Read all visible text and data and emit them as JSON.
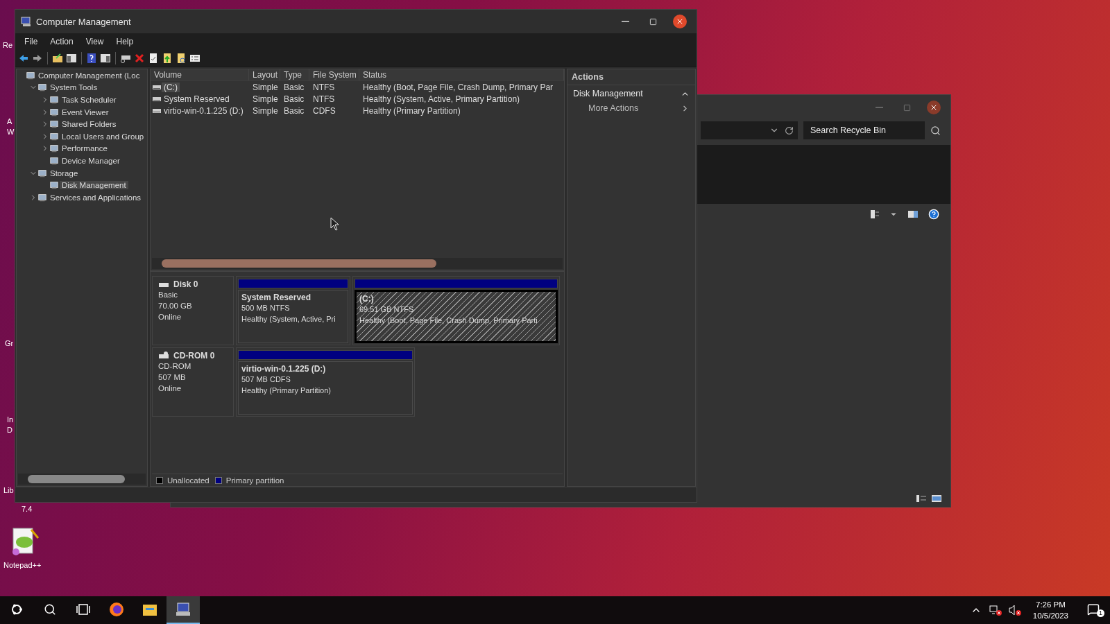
{
  "desktop": {
    "icons": [
      {
        "lines": [
          "Re"
        ]
      },
      {
        "lines": [
          "A",
          "W"
        ]
      },
      {
        "lines": [
          "Gr"
        ]
      },
      {
        "lines": [
          "In",
          "D"
        ]
      },
      {
        "lines": [
          "Lib",
          "7.4"
        ]
      },
      {
        "lines": [
          "Notepad++"
        ]
      }
    ]
  },
  "window": {
    "title": "Computer Management",
    "menu": [
      "File",
      "Action",
      "View",
      "Help"
    ],
    "tree": [
      {
        "label": "Computer Management (Loc",
        "selected": false,
        "children": [
          {
            "label": "System Tools",
            "expanded": true,
            "selected": false,
            "children": [
              {
                "label": "Task Scheduler",
                "expanded": false,
                "selected": false
              },
              {
                "label": "Event Viewer",
                "expanded": false,
                "selected": false
              },
              {
                "label": "Shared Folders",
                "expanded": false,
                "selected": false
              },
              {
                "label": "Local Users and Group",
                "expanded": false,
                "selected": false
              },
              {
                "label": "Performance",
                "expanded": false,
                "selected": false
              },
              {
                "label": "Device Manager",
                "selected": false
              }
            ]
          },
          {
            "label": "Storage",
            "expanded": true,
            "selected": false,
            "children": [
              {
                "label": "Disk Management",
                "selected": true
              }
            ]
          },
          {
            "label": "Services and Applications",
            "expanded": false,
            "selected": false
          }
        ]
      }
    ],
    "volumes": {
      "columns": [
        "Volume",
        "Layout",
        "Type",
        "File System",
        "Status"
      ],
      "rows": [
        {
          "selected": true,
          "cells": [
            "(C:)",
            "Simple",
            "Basic",
            "NTFS",
            "Healthy (Boot, Page File, Crash Dump, Primary Par"
          ]
        },
        {
          "selected": false,
          "cells": [
            "System Reserved",
            "Simple",
            "Basic",
            "NTFS",
            "Healthy (System, Active, Primary Partition)"
          ]
        },
        {
          "selected": false,
          "cells": [
            "virtio-win-0.1.225 (D:)",
            "Simple",
            "Basic",
            "CDFS",
            "Healthy (Primary Partition)"
          ]
        }
      ]
    },
    "disks": [
      {
        "name": "Disk 0",
        "type": "Basic",
        "size": "70.00 GB",
        "status": "Online",
        "partitions": [
          {
            "name": "System Reserved",
            "size": "500 MB NTFS",
            "status": "Healthy (System, Active, Pri",
            "selected": false
          },
          {
            "name": "(C:)",
            "size": "69.51 GB NTFS",
            "status": "Healthy (Boot, Page File, Crash Dump, Primary Parti",
            "selected": true
          }
        ]
      },
      {
        "name": "CD-ROM 0",
        "type": "CD-ROM",
        "size": "507 MB",
        "status": "Online",
        "partitions": [
          {
            "name": "virtio-win-0.1.225  (D:)",
            "size": "507 MB CDFS",
            "status": "Healthy (Primary Partition)",
            "selected": false
          }
        ]
      }
    ],
    "legend": [
      {
        "label": "Unallocated",
        "color": "#000000"
      },
      {
        "label": "Primary partition",
        "color": "#000080"
      }
    ],
    "actions": {
      "title": "Actions",
      "section": {
        "label": "Disk Management",
        "expanded": true
      },
      "items": [
        "More Actions"
      ]
    }
  },
  "recycle_bin": {
    "search": {
      "placeholder": "Search Recycle Bin"
    }
  },
  "taskbar": {
    "apps": [
      {
        "selected": false
      },
      {
        "selected": false
      },
      {
        "selected": true
      }
    ],
    "time": "7:26 PM",
    "date": "10/5/2023",
    "notifications": "1"
  }
}
